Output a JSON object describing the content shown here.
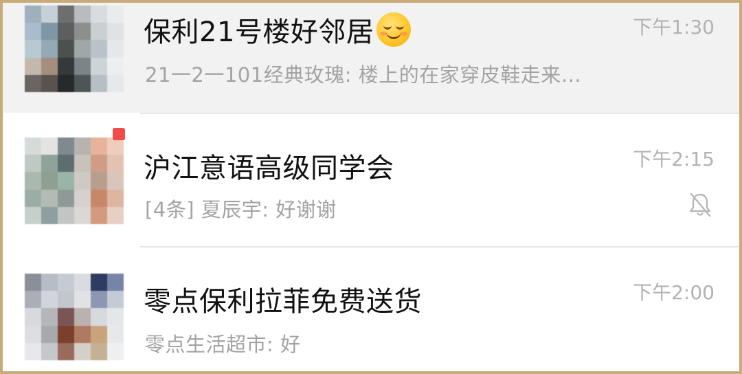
{
  "chats": [
    {
      "title": "保利21号楼好邻居",
      "title_emoji": "relieved-face-emoji",
      "preview": "21一2一101经典玫瑰: 楼上的在家穿皮鞋走来…",
      "time": "下午1:30",
      "pinned": true,
      "muted": false,
      "avatar_icon": "group-avatar-icon"
    },
    {
      "title": "沪江意语高级同学会",
      "preview": "[4条] 夏辰宇: 好谢谢",
      "time": "下午2:15",
      "pinned": false,
      "muted": true,
      "unread_dot": true,
      "avatar_icon": "group-avatar-icon",
      "mute_icon": "bell-muted-icon"
    },
    {
      "title": "零点保利拉菲免费送货",
      "preview": "零点生活超市: 好",
      "time": "下午2:00",
      "pinned": false,
      "muted": false,
      "avatar_icon": "group-avatar-icon"
    }
  ],
  "colors": {
    "border": "#c8ab79",
    "pinned_background": "#f2f2f2",
    "title_text": "#111111",
    "preview_text": "#a3a3a3",
    "time_text": "#b2b2b2",
    "unread_dot": "#f04a4a"
  }
}
